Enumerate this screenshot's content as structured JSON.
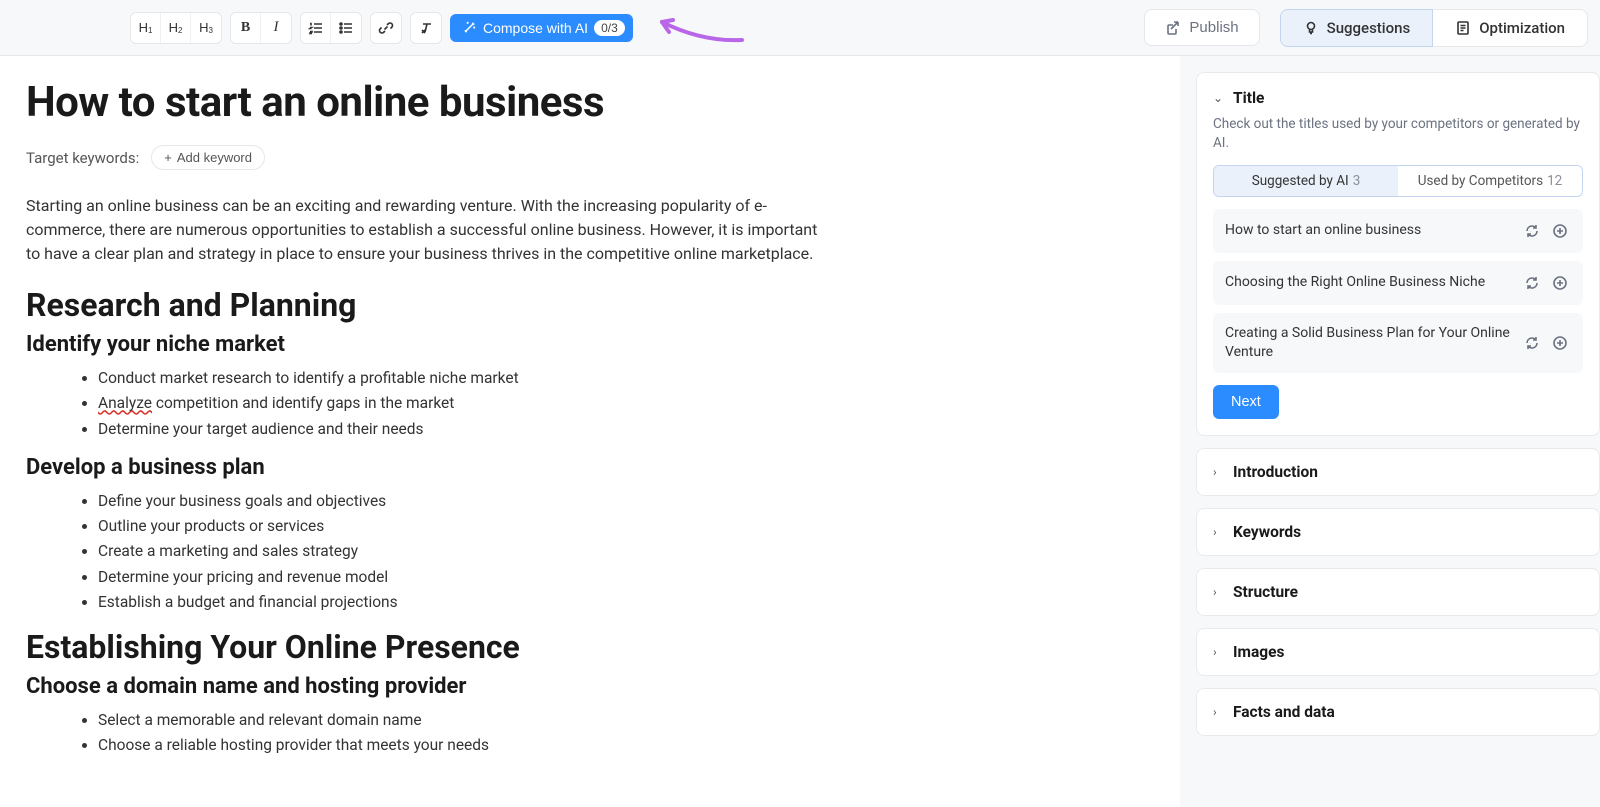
{
  "toolbar": {
    "compose_label": "Compose with AI",
    "compose_badge": "0/3",
    "publish_label": "Publish",
    "suggestions_tab": "Suggestions",
    "optimization_tab": "Optimization"
  },
  "document": {
    "title": "How to start an online business",
    "keywords_label": "Target keywords:",
    "add_keyword_label": "Add keyword",
    "intro": "Starting an online business can be an exciting and rewarding venture. With the increasing popularity of e-commerce, there are numerous opportunities to establish a successful online business. However, it is important to have a clear plan and strategy in place to ensure your business thrives in the competitive online marketplace.",
    "h2_a": "Research and Planning",
    "h3_a1": "Identify your niche market",
    "li_a1_1": "Conduct market research to identify a profitable niche market",
    "li_a1_2_pre": "Analyze",
    "li_a1_2_post": " competition and identify gaps in the market",
    "li_a1_3": "Determine your target audience and their needs",
    "h3_a2": "Develop a business plan",
    "li_a2_1": "Define your business goals and objectives",
    "li_a2_2": "Outline your products or services",
    "li_a2_3": "Create a marketing and sales strategy",
    "li_a2_4": "Determine your pricing and revenue model",
    "li_a2_5": "Establish a budget and financial projections",
    "h2_b": "Establishing Your Online Presence",
    "h3_b1": "Choose a domain name and hosting provider",
    "li_b1_1": "Select a memorable and relevant domain name",
    "li_b1_2": "Choose a reliable hosting provider that meets your needs"
  },
  "suggestions_panel": {
    "title": "Title",
    "desc": "Check out the titles used by your competitors or generated by AI.",
    "tab_ai": "Suggested by AI",
    "tab_ai_count": "3",
    "tab_comp": "Used by Competitors",
    "tab_comp_count": "12",
    "items": [
      "How to start an online business",
      "Choosing the Right Online Business Niche",
      "Creating a Solid Business Plan for Your Online Venture"
    ],
    "next_label": "Next"
  },
  "sections": {
    "introduction": "Introduction",
    "keywords": "Keywords",
    "structure": "Structure",
    "images": "Images",
    "facts": "Facts and data"
  }
}
